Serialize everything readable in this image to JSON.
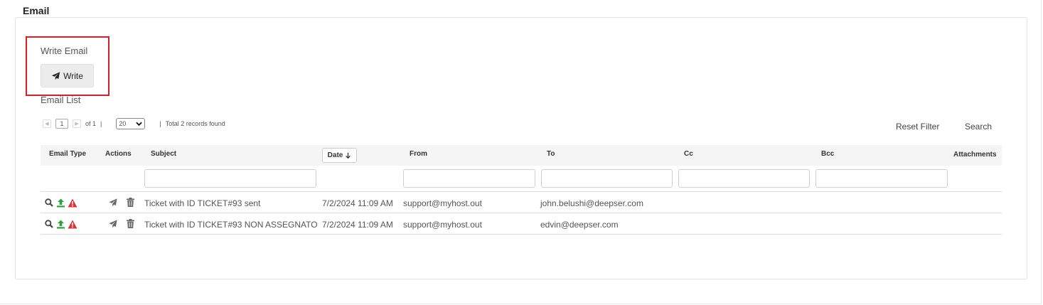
{
  "section": {
    "title": "Email"
  },
  "write": {
    "label": "Write Email",
    "button_label": "Write"
  },
  "list": {
    "label": "Email List"
  },
  "pager": {
    "page": "1",
    "of_text": "of 1",
    "separator": "|",
    "page_size": "20",
    "total_text": "Total 2 records found"
  },
  "filters": {
    "reset_label": "Reset Filter",
    "search_label": "Search"
  },
  "columns": {
    "email_type": "Email Type",
    "actions": "Actions",
    "subject": "Subject",
    "date": "Date",
    "from": "From",
    "to": "To",
    "cc": "Cc",
    "bcc": "Bcc",
    "attachments": "Attachments"
  },
  "rows": [
    {
      "subject": "Ticket with ID TICKET#93 sent",
      "date": "7/2/2024 11:09 AM",
      "from": "support@myhost.out",
      "to": "john.belushi@deepser.com",
      "cc": "",
      "bcc": ""
    },
    {
      "subject": "Ticket with ID TICKET#93 NON ASSEGNATO",
      "date": "7/2/2024 11:09 AM",
      "from": "support@myhost.out",
      "to": "edvin@deepser.com",
      "cc": "",
      "bcc": ""
    }
  ],
  "colors": {
    "highlight": "#d9202a",
    "upload_icon": "#2e9e3e",
    "warning_icon": "#d9343b"
  },
  "icons": {
    "write": "paper-plane-icon",
    "view": "magnifier-icon",
    "outgoing": "upload-arrow-icon",
    "warning": "warning-triangle-icon",
    "send": "paper-plane-icon",
    "delete": "trash-icon",
    "sort": "arrow-down-icon"
  }
}
